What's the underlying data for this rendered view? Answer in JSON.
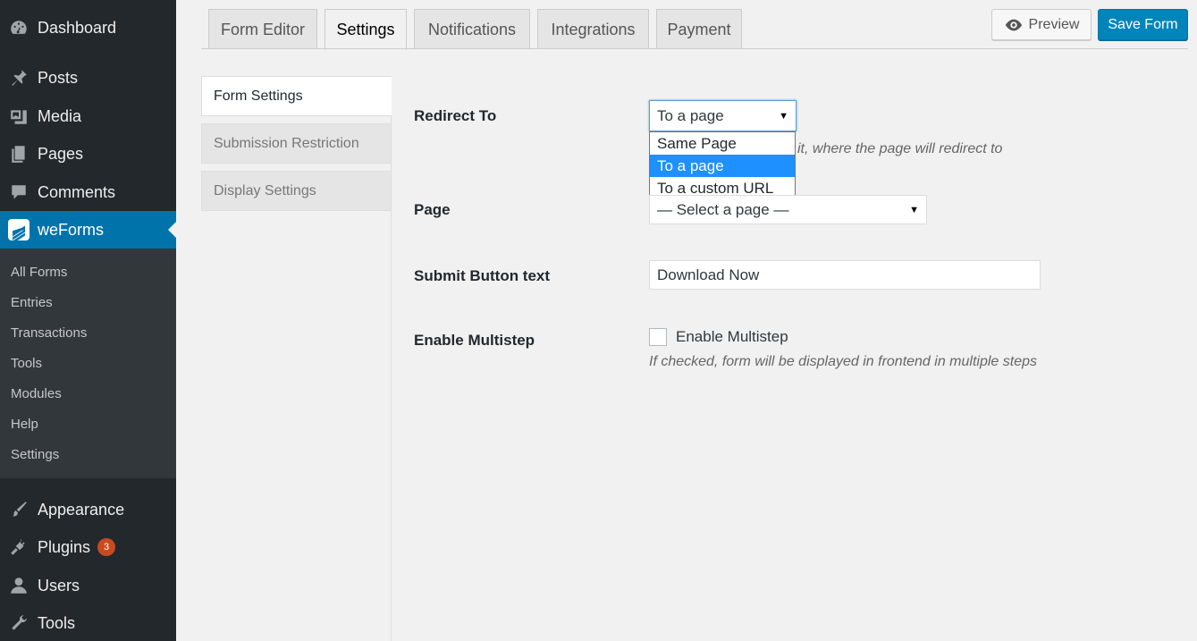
{
  "sidebar": {
    "items": [
      {
        "label": "Dashboard",
        "icon": "dashboard-icon"
      },
      {
        "label": "Posts",
        "icon": "pin-icon"
      },
      {
        "label": "Media",
        "icon": "media-icon"
      },
      {
        "label": "Pages",
        "icon": "pages-icon"
      },
      {
        "label": "Comments",
        "icon": "comment-icon"
      },
      {
        "label": "weForms",
        "icon": "weforms-icon"
      },
      {
        "label": "Appearance",
        "icon": "brush-icon"
      },
      {
        "label": "Plugins",
        "icon": "plugin-icon",
        "badge": "3"
      },
      {
        "label": "Users",
        "icon": "user-icon"
      },
      {
        "label": "Tools",
        "icon": "wrench-icon"
      }
    ],
    "submenu": [
      "All Forms",
      "Entries",
      "Transactions",
      "Tools",
      "Modules",
      "Help",
      "Settings"
    ]
  },
  "tabs": [
    "Form Editor",
    "Settings",
    "Notifications",
    "Integrations",
    "Payment"
  ],
  "actions": {
    "preview": "Preview",
    "save": "Save Form"
  },
  "settings_nav": [
    "Form Settings",
    "Submission Restriction",
    "Display Settings"
  ],
  "form": {
    "redirect_label": "Redirect To",
    "redirect_value": "To a page",
    "redirect_options": [
      "Same Page",
      "To a page",
      "To a custom URL"
    ],
    "redirect_help": "it, where the page will redirect to",
    "page_label": "Page",
    "page_value": "— Select a page —",
    "submit_label": "Submit Button text",
    "submit_value": "Download Now",
    "multistep_label": "Enable Multistep",
    "multistep_check_label": "Enable Multistep",
    "multistep_help": "If checked, form will be displayed in frontend in multiple steps"
  },
  "colors": {
    "accent": "#0073aa",
    "sidebar": "#23282d",
    "submenu": "#32373c",
    "badge": "#ca4a1f"
  }
}
